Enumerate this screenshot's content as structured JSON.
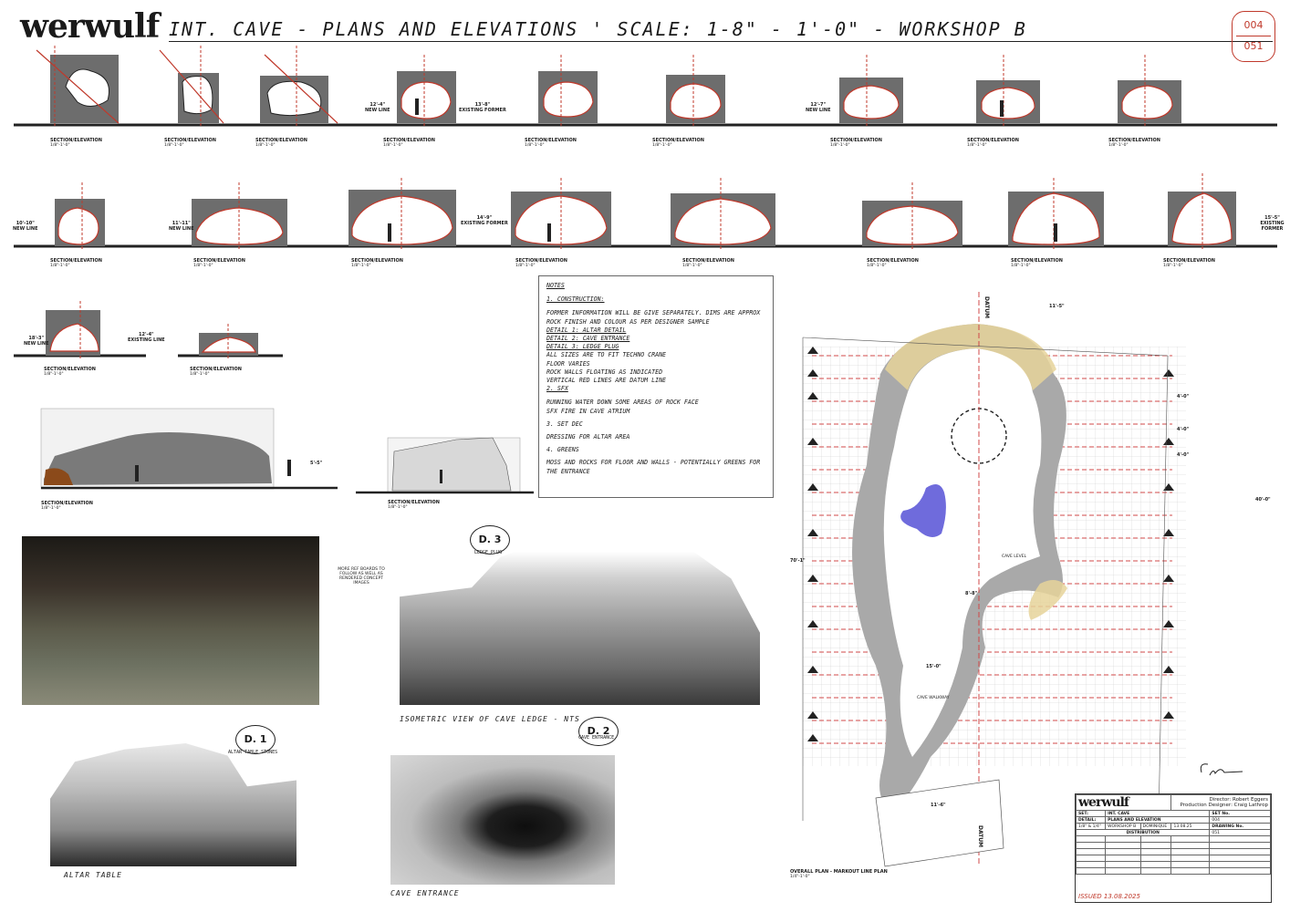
{
  "header": {
    "logo": "werwulf",
    "title": "INT.   CAVE -   PLANS AND ELEVATIONS ' SCALE: 1-8\" - 1'-0\" - WORKSHOP B",
    "sheet_number": "004",
    "sheet_total": "051"
  },
  "row1_sections": [
    {
      "letter": "A",
      "label": "SECTION/ELEVATION",
      "scale": "1/8\"-1'-0\""
    },
    {
      "letter": "B",
      "label": "SECTION/ELEVATION",
      "scale": "1/8\"-1'-0\""
    },
    {
      "letter": "C",
      "label": "SECTION/ELEVATION",
      "scale": "1/8\"-1'-0\""
    },
    {
      "letter": "D",
      "label": "SECTION/ELEVATION",
      "scale": "1/8\"-1'-0\""
    },
    {
      "letter": "E",
      "label": "SECTION/ELEVATION",
      "scale": "1/8\"-1'-0\""
    },
    {
      "letter": "F",
      "label": "SECTION/ELEVATION",
      "scale": "1/8\"-1'-0\""
    },
    {
      "letter": "G",
      "label": "SECTION/ELEVATION",
      "scale": "1/8\"-1'-0\""
    },
    {
      "letter": "H",
      "label": "SECTION/ELEVATION",
      "scale": "1/8\"-1'-0\""
    },
    {
      "letter": "I",
      "label": "SECTION/ELEVATION",
      "scale": "1/8\"-1'-0\""
    }
  ],
  "row2_sections": [
    {
      "letter": "J",
      "label": "SECTION/ELEVATION",
      "scale": "1/8\"-1'-0\""
    },
    {
      "letter": "K",
      "label": "SECTION/ELEVATION",
      "scale": "1/8\"-1'-0\""
    },
    {
      "letter": "L",
      "label": "SECTION/ELEVATION",
      "scale": "1/8\"-1'-0\""
    },
    {
      "letter": "M",
      "label": "SECTION/ELEVATION",
      "scale": "1/8\"-1'-0\""
    },
    {
      "letter": "N",
      "label": "SECTION/ELEVATION",
      "scale": "1/8\"-1'-0\""
    },
    {
      "letter": "O",
      "label": "SECTION/ELEVATION",
      "scale": "1/8\"-1'-0\""
    },
    {
      "letter": "P",
      "label": "SECTION/ELEVATION",
      "scale": "1/8\"-1'-0\""
    },
    {
      "letter": "Q",
      "label": "SECTION/ELEVATION",
      "scale": "1/8\"-1'-0\""
    }
  ],
  "row3_sections": [
    {
      "letter": "R",
      "label": "SECTION/ELEVATION",
      "scale": "1/8\"-1'-0\""
    },
    {
      "letter": "S",
      "label": "SECTION/ELEVATION",
      "scale": "1/8\"-1'-0\""
    }
  ],
  "long_section": {
    "letter": "X",
    "label": "SECTION/ELEVATION",
    "scale": "1/8\"-1'-0\""
  },
  "side_section": {
    "letter": "Y",
    "label": "SECTION/ELEVATION",
    "scale": "1/8\"-1'-0\""
  },
  "dims": {
    "new_line": "NEW LINE",
    "existing_former": "EXISTING FORMER",
    "existing_line": "EXISTING LINE",
    "d_12_4": "12'-4\"",
    "d_12_7": "12'-7\"",
    "d_13_8": "13'-8\"",
    "d_14_9": "14'-9\"",
    "d_15_5": "15'-5\"",
    "d_10_10": "10'-10\"",
    "d_11_11": "11'-11\"",
    "d_18_3": "18'-3\"",
    "d_5_5": "5'-5\""
  },
  "notes": {
    "heading": "NOTES",
    "s1": "1.   CONSTRUCTION:",
    "l1": "FORMER INFORMATION WILL BE GIVE SEPARATELY. DIMS ARE APPROX",
    "l2": "ROCK FINISH AND COLOUR AS PER DESIGNER SAMPLE",
    "l3": "DETAIL 1: ALTAR DETAIL",
    "l4": "DETAIL 2: CAVE ENTRANCE",
    "l5": "DETAIL 3: LEDGE PLUG",
    "l6": "ALL SIZES ARE TO FIT TECHNO CRANE",
    "l7": "FLOOR VARIES",
    "l8": "ROCK WALLS FLOATING AS INDICATED",
    "l9": "VERTICAL RED LINES ARE DATUM LINE",
    "s2": "2.   SFX",
    "l10": "RUNNING WATER DOWN SOME AREAS OF ROCK FACE",
    "l11": "SFX FIRE IN CAVE ATRIUM",
    "s3": "3.   SET DEC",
    "l12": "DRESSING FOR ALTAR AREA",
    "s4": "4.   GREENS",
    "l13": "MOSS AND ROCKS FOR FLOOR AND WALLS - POTENTIALLY GREENS FOR THE ENTRANCE"
  },
  "details": {
    "d1_tag": "D. 1",
    "d1_sub": "ALTAR TABLE STONES",
    "d1_caption": "ALTAR TABLE",
    "d2_tag": "D. 2",
    "d2_sub": "CAVE ENTRANCE",
    "d2_caption": "CAVE ENTRANCE",
    "d3_tag": "D. 3",
    "d3_sub": "LEDGE PLUG",
    "d3_caption": "ISOMETRIC VIEW OF CAVE LEDGE - NTS",
    "ref_note": "MORE REF BOARDS TO FOLLOW AS WELL AS RENDERED CONCEPT IMAGES"
  },
  "plan": {
    "label": "OVERALL PLAN - MARKOUT LINE PLAN",
    "scale": "1/4\"-1'-0\"",
    "datum": "DATUM",
    "dim_top": "11'-5\"",
    "dim_bottom": "11'-6\"",
    "dim_left": "70'-1\"",
    "dim_right": "40'-0\"",
    "dim_15": "15'-0\"",
    "dim_8": "8'-8\"",
    "dim_4": "4'-0\"",
    "cave_walkway": "CAVE WALKWAY",
    "cave_level": "CAVE LEVEL"
  },
  "title_block": {
    "logo": "werwulf",
    "director": "Director: Robert Eggers",
    "designer": "Production Designer: Craig Lathrop",
    "set_label": "SET:",
    "set_value": "INT. CAVE",
    "set_no_label": "SET No.",
    "set_no": "004",
    "detail_label": "DETAIL:",
    "detail_value": "PLANS AND ELEVATION",
    "drawing_no_label": "DRAWING No.",
    "drawing_no": "051",
    "scale": "1/8\" & 1/4\"",
    "stage": "WORKSHOP B",
    "drawn": "DOMINIQUE",
    "date": "13.08.25",
    "distribution": "DISTRIBUTION"
  },
  "issued": "ISSUED 13.08.2025"
}
